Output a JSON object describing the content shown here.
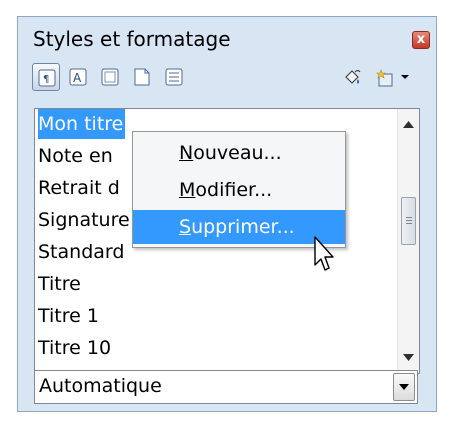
{
  "window": {
    "title": "Styles et formatage",
    "close_label": "x"
  },
  "toolbar": {
    "buttons": [
      {
        "name": "paragraph-styles-icon",
        "active": true
      },
      {
        "name": "character-styles-icon",
        "active": false
      },
      {
        "name": "frame-styles-icon",
        "active": false
      },
      {
        "name": "page-styles-icon",
        "active": false
      },
      {
        "name": "list-styles-icon",
        "active": false
      },
      {
        "name": "fill-format-mode-icon",
        "active": false
      },
      {
        "name": "new-style-from-selection-icon",
        "active": false
      }
    ]
  },
  "style_list": {
    "items": [
      {
        "label": "Mon titre",
        "selected": true
      },
      {
        "label": "Note en",
        "selected": false
      },
      {
        "label": "Retrait d",
        "selected": false
      },
      {
        "label": "Signature",
        "selected": false
      },
      {
        "label": "Standard",
        "selected": false
      },
      {
        "label": "Titre",
        "selected": false
      },
      {
        "label": "Titre 1",
        "selected": false
      },
      {
        "label": "Titre 10",
        "selected": false
      }
    ]
  },
  "context_menu": {
    "items": [
      {
        "accel": "N",
        "rest": "ouveau...",
        "highlighted": false
      },
      {
        "accel": "M",
        "rest": "odifier...",
        "highlighted": false
      },
      {
        "accel": "S",
        "rest": "upprimer...",
        "highlighted": true
      }
    ]
  },
  "filter_dropdown": {
    "value": "Automatique"
  },
  "colors": {
    "selection": "#3399ff",
    "panel": "#d8e5f3"
  }
}
